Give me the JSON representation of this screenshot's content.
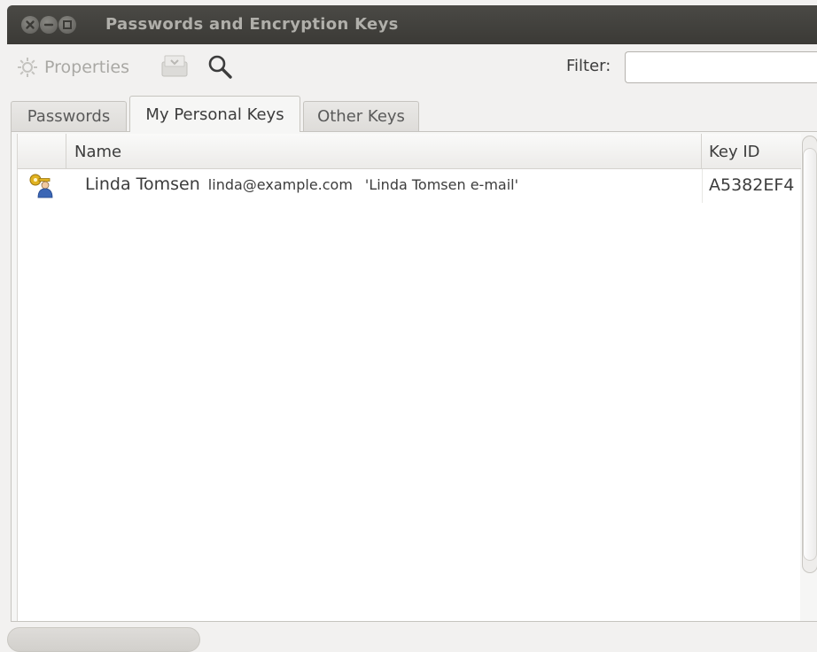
{
  "window": {
    "title": "Passwords and Encryption Keys"
  },
  "toolbar": {
    "properties_label": "Properties",
    "filter_label": "Filter:",
    "filter_value": "",
    "icons": [
      "gear-icon",
      "export-icon",
      "search-icon"
    ]
  },
  "tabs": [
    {
      "label": "Passwords",
      "active": false
    },
    {
      "label": "My Personal Keys",
      "active": true
    },
    {
      "label": "Other Keys",
      "active": false
    }
  ],
  "table": {
    "columns": [
      "Name",
      "Key ID"
    ],
    "rows": [
      {
        "icon": "personal-key-icon",
        "name": "Linda Tomsen",
        "email": "linda@example.com",
        "comment": "'Linda Tomsen e-mail'",
        "key_id": "A5382EF4"
      }
    ]
  },
  "colors": {
    "titlebar": "#3e3d39",
    "window_bg": "#f2f1f0",
    "list_bg": "#ffffff"
  }
}
